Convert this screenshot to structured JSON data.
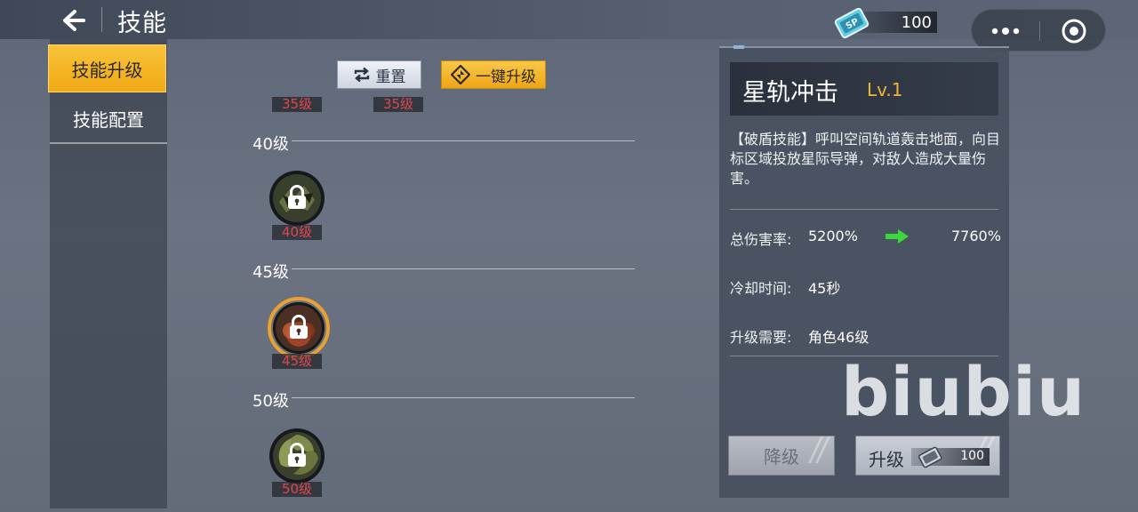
{
  "header": {
    "title": "技能"
  },
  "currency": {
    "icon": "sp-ticket-icon",
    "icon_text": "SP",
    "value": "100"
  },
  "sidebar": {
    "tabs": [
      {
        "label": "技能升级",
        "active": true
      },
      {
        "label": "技能配置",
        "active": false
      }
    ]
  },
  "actions": {
    "reset_label": "重置",
    "oneclick_label": "一键升级"
  },
  "tree": {
    "top_tags": [
      "35级",
      "35级"
    ],
    "sections": [
      {
        "label": "40级",
        "node_tag": "40级",
        "selected": false
      },
      {
        "label": "45级",
        "node_tag": "45级",
        "selected": true
      },
      {
        "label": "50级",
        "node_tag": "50级",
        "selected": false
      }
    ]
  },
  "detail": {
    "name": "星轨冲击",
    "level": "Lv.1",
    "description": "【破盾技能】呼叫空间轨道轰击地面，向目标区域投放星际导弹，对敌人造成大量伤害。",
    "damage_label": "总伤害率:",
    "damage_current": "5200%",
    "damage_next": "7760%",
    "cooldown_label": "冷却时间:",
    "cooldown_value": "45秒",
    "req_label": "升级需要:",
    "req_value": "角色46级",
    "downgrade_label": "降级",
    "upgrade_label": "升级",
    "upgrade_cost": "100"
  },
  "watermark": "biubiu",
  "colors": {
    "accent": "#f1a815",
    "level_tag": "#e0474b",
    "arrow": "#3bd83b",
    "level_text": "#f2b630"
  }
}
